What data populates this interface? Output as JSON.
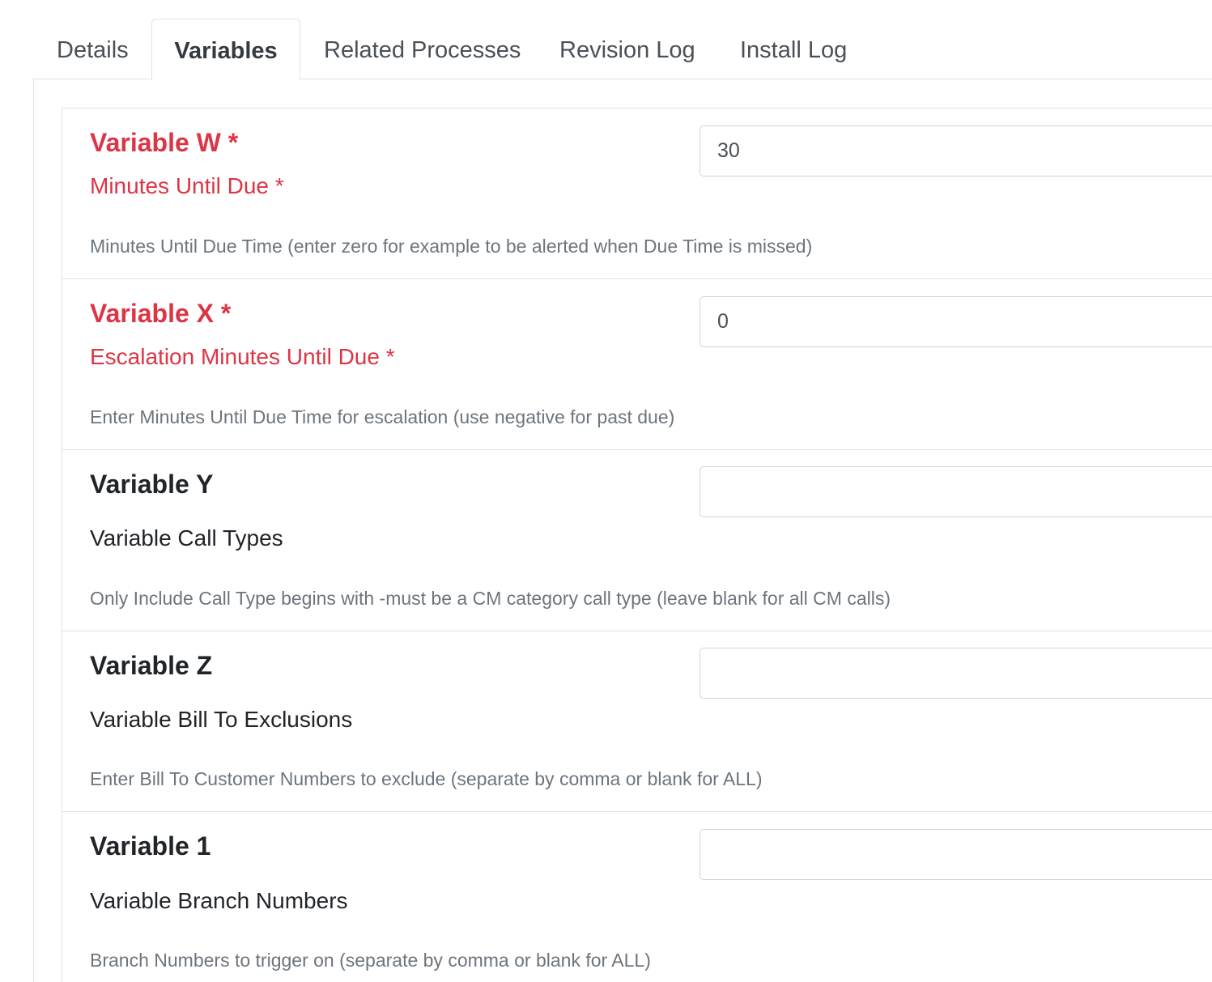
{
  "tabs": [
    {
      "label": "Details",
      "active": false
    },
    {
      "label": "Variables",
      "active": true
    },
    {
      "label": "Related Processes",
      "active": false
    },
    {
      "label": "Revision Log",
      "active": false
    },
    {
      "label": "Install Log",
      "active": false
    }
  ],
  "variables": [
    {
      "title": "Variable W *",
      "label": "Minutes Until Due *",
      "help": "Minutes Until Due Time (enter zero for example to be alerted when Due Time is missed)",
      "value": "30",
      "required": true
    },
    {
      "title": "Variable X *",
      "label": "Escalation Minutes Until Due *",
      "help": "Enter Minutes Until Due  Time for escalation (use negative for past due)",
      "value": "0",
      "required": true
    },
    {
      "title": "Variable Y",
      "label": "Variable Call Types",
      "help": "Only Include Call Type begins with -must be a CM category call type (leave blank for all CM calls)",
      "value": "",
      "required": false
    },
    {
      "title": "Variable Z",
      "label": "Variable Bill To Exclusions",
      "help": "Enter Bill To Customer Numbers to exclude (separate by comma or blank for ALL)",
      "value": "",
      "required": false
    },
    {
      "title": "Variable 1",
      "label": "Variable Branch Numbers",
      "help": "Branch Numbers to trigger on (separate by comma or blank for ALL)",
      "value": "",
      "required": false
    }
  ],
  "colors": {
    "required_text": "#dc3545",
    "help_text": "#6c757d",
    "border": "#dee2e6"
  }
}
